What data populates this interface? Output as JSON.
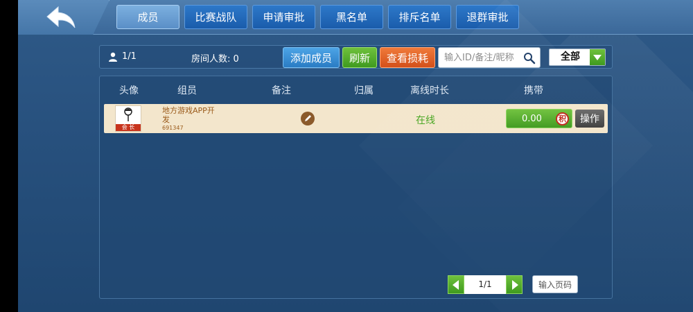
{
  "tabs": [
    {
      "label": "成员",
      "active": true
    },
    {
      "label": "比赛战队",
      "active": false
    },
    {
      "label": "申请审批",
      "active": false
    },
    {
      "label": "黑名单",
      "active": false
    },
    {
      "label": "排斥名单",
      "active": false
    },
    {
      "label": "退群审批",
      "active": false
    }
  ],
  "toolbar": {
    "member_count": "1/1",
    "room_count": "房间人数: 0",
    "add_label": "添加成员",
    "refresh_label": "刷新",
    "loss_label": "查看损耗",
    "search_placeholder": "输入ID/备注/昵称",
    "filter_label": "全部"
  },
  "table": {
    "headers": [
      "头像",
      "组员",
      "备注",
      "归属",
      "离线时长",
      "携带"
    ],
    "rows": [
      {
        "badge": "会 长",
        "name": "地方游戏APP开发",
        "id": "691347",
        "status": "在线",
        "carry": "0.00",
        "carry_icon": "积",
        "action": "操作"
      }
    ]
  },
  "pagination": {
    "page": "1/1",
    "goto_label": "输入页码"
  },
  "colors": {
    "accent_green": "#3f9a1f",
    "accent_blue": "#2a7cc4",
    "accent_orange": "#d4501a",
    "status_online": "#46a51f"
  }
}
